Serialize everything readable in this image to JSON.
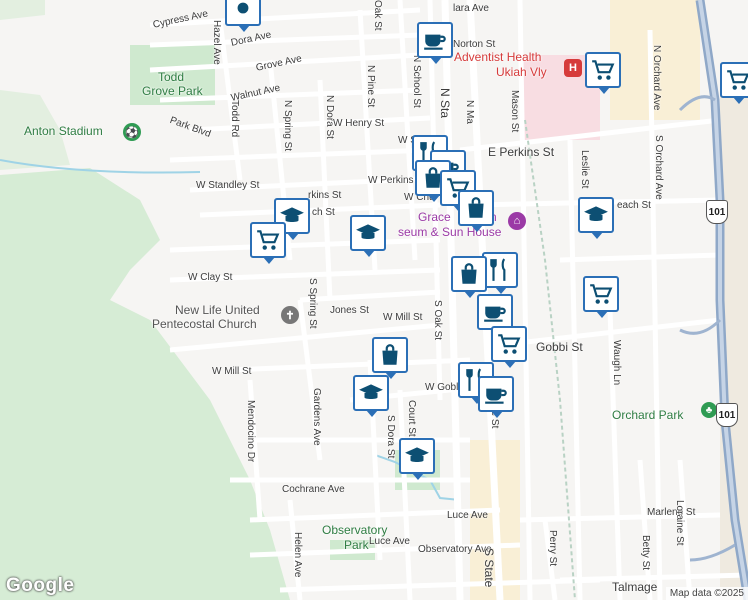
{
  "streets": {
    "cypress_ave": "Cypress Ave",
    "dora_ave": "Dora Ave",
    "grove_ave": "Grove Ave",
    "walnut_ave": "Walnut Ave",
    "park_blvd": "Park Blvd",
    "hazel_ave": "Hazel Ave",
    "todd_rd": "Todd Rd",
    "n_spring_st": "N Spring St",
    "n_dora_st": "N Dora St",
    "n_pine_st": "N Pine St",
    "n_school_st": "N School St",
    "oak_st_top": "Oak St",
    "norton_st": "Norton St",
    "w_henry_st": "W Henry St",
    "w_standley_st": "W Standley St",
    "w_perkins_st": "W Perkins St",
    "perkins_st_short": "rkins St",
    "e_perkins_st": "E Perkins St",
    "church_st": "ch St",
    "w_church": "W Chu",
    "w_smith": "W Sn",
    "w_clay_st": "W Clay St",
    "jones_st": "Jones St",
    "s_spring_st": "S Spring St",
    "w_mill_st": "W Mill St",
    "w_mill_st_2": "W Mill St",
    "s_oak_st": "S Oak St",
    "w_gobbi": "W Gobl",
    "gobbi_st": "Gobbi St",
    "mendocino_dr": "Mendocino Dr",
    "gardens_ave": "Gardens Ave",
    "court_st": "Court St",
    "s_dora_st": "S Dora St",
    "cochrane_ave": "Cochrane Ave",
    "luce_ave": "Luce Ave",
    "luce_ave_2": "Luce Ave",
    "observatory_ave": "Observatory Ave",
    "helen_ave": "Helen Ave",
    "mason_st": "Mason St",
    "leslie_st": "Leslie St",
    "n_orchard_ave": "N Orchard Ave",
    "s_orchard_ave": "S Orchard Ave",
    "beach_st": "each St",
    "waugh_ln": "Waugh Ln",
    "marlene_st": "Marlene St",
    "loraine_st": "Loraine St",
    "betty_st": "Betty St",
    "perry_st": "Perry St",
    "talmage": "Talmage",
    "n_state": "N Sta",
    "n_main": "N Ma",
    "s_state_lower": "S State",
    "clara_ave": "lara Ave",
    "s_main": "ue St"
  },
  "places": {
    "todd_grove_park_1": "Todd",
    "todd_grove_park_2": "Grove Park",
    "anton_stadium": "Anton Stadium",
    "new_life_1": "New Life United",
    "new_life_2": "Pentecostal Church",
    "grace_museum_1": "Grace",
    "grace_museum_2": "seum & Sun House",
    "grace_museum_mid": "n",
    "adventist_1": "Adventist Health",
    "adventist_2": "Ukiah Vly",
    "orchard_park": "Orchard Park",
    "observatory_park_1": "Observatory",
    "observatory_park_2": "Park"
  },
  "highway": {
    "route_label_1": "101",
    "route_label_2": "101"
  },
  "branding": {
    "google": "Google",
    "attribution": "Map data ©2025"
  },
  "colors": {
    "pin_border": "#2b6fb6",
    "park_green": "#cfe9cf",
    "hill_green": "#d6ecd5",
    "highway": "#8fa8c8",
    "hospital_pink": "#f8dde2",
    "commercial": "#f9efd6"
  }
}
